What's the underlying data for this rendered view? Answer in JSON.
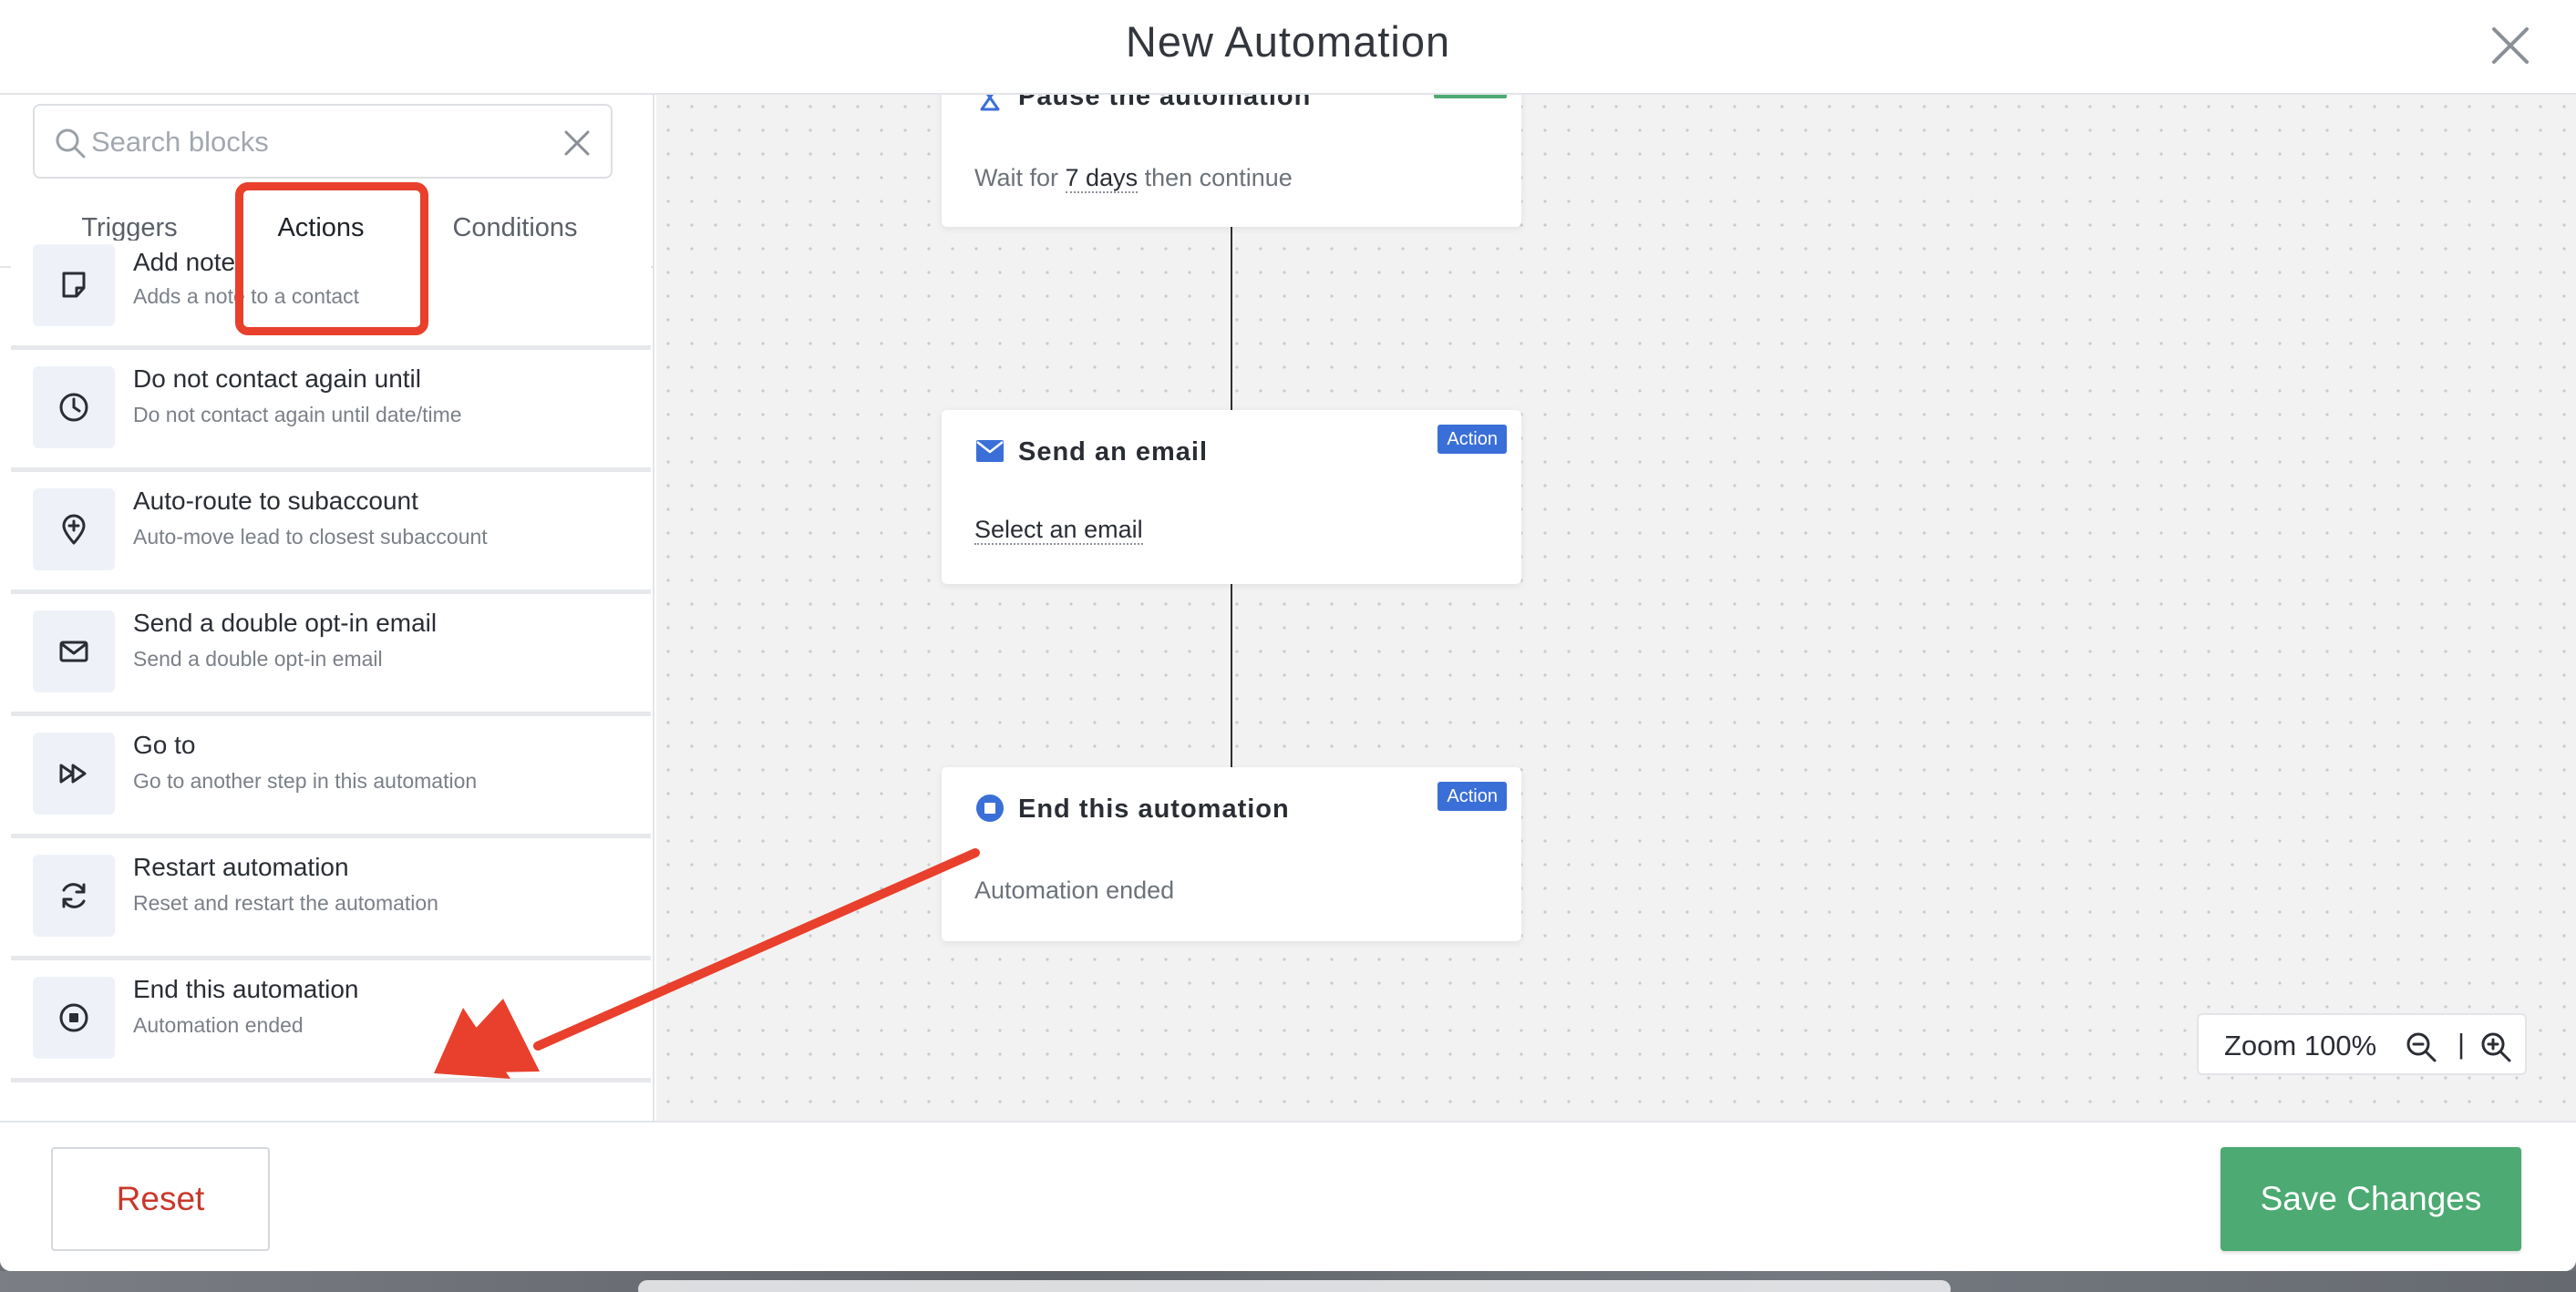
{
  "modal": {
    "title": "New Automation"
  },
  "search": {
    "placeholder": "Search blocks",
    "value": ""
  },
  "tabs": [
    {
      "label": "Triggers"
    },
    {
      "label": "Actions",
      "active": true
    },
    {
      "label": "Conditions"
    }
  ],
  "blocks": [
    {
      "title": "Add note",
      "subtitle": "Adds a note to a contact",
      "icon": "note-icon"
    },
    {
      "title": "Do not contact again until",
      "subtitle": "Do not contact again until date/time",
      "icon": "clock-icon"
    },
    {
      "title": "Auto-route to subaccount",
      "subtitle": "Auto-move lead to closest subaccount",
      "icon": "map-pin-plus-icon"
    },
    {
      "title": "Send a double opt-in email",
      "subtitle": "Send a double opt-in email",
      "icon": "envelope-icon"
    },
    {
      "title": "Go to",
      "subtitle": "Go to another step in this automation",
      "icon": "fast-forward-icon"
    },
    {
      "title": "Restart automation",
      "subtitle": "Reset and restart the automation",
      "icon": "refresh-icon"
    },
    {
      "title": "End this automation",
      "subtitle": "Automation ended",
      "icon": "stop-circle-icon"
    }
  ],
  "canvas": {
    "nodes": [
      {
        "title": "Pause the automation",
        "icon": "hourglass-icon",
        "body_prefix": "Wait for",
        "body_value": "7 days",
        "body_suffix": "then continue"
      },
      {
        "title": "Send an email",
        "icon": "envelope-icon",
        "badge": "Action",
        "body": "Select an email"
      },
      {
        "title": "End this automation",
        "icon": "stop-circle-icon",
        "badge": "Action",
        "body": "Automation ended"
      }
    ],
    "zoom": {
      "label": "Zoom 100%",
      "separator": "|"
    }
  },
  "footer": {
    "reset_label": "Reset",
    "save_label": "Save Changes"
  },
  "colors": {
    "accent_blue": "#3b6fd8",
    "save_green": "#4caa72",
    "reset_red": "#c8382b",
    "annotation_red": "#e8402c",
    "status_green": "#4caa72"
  }
}
